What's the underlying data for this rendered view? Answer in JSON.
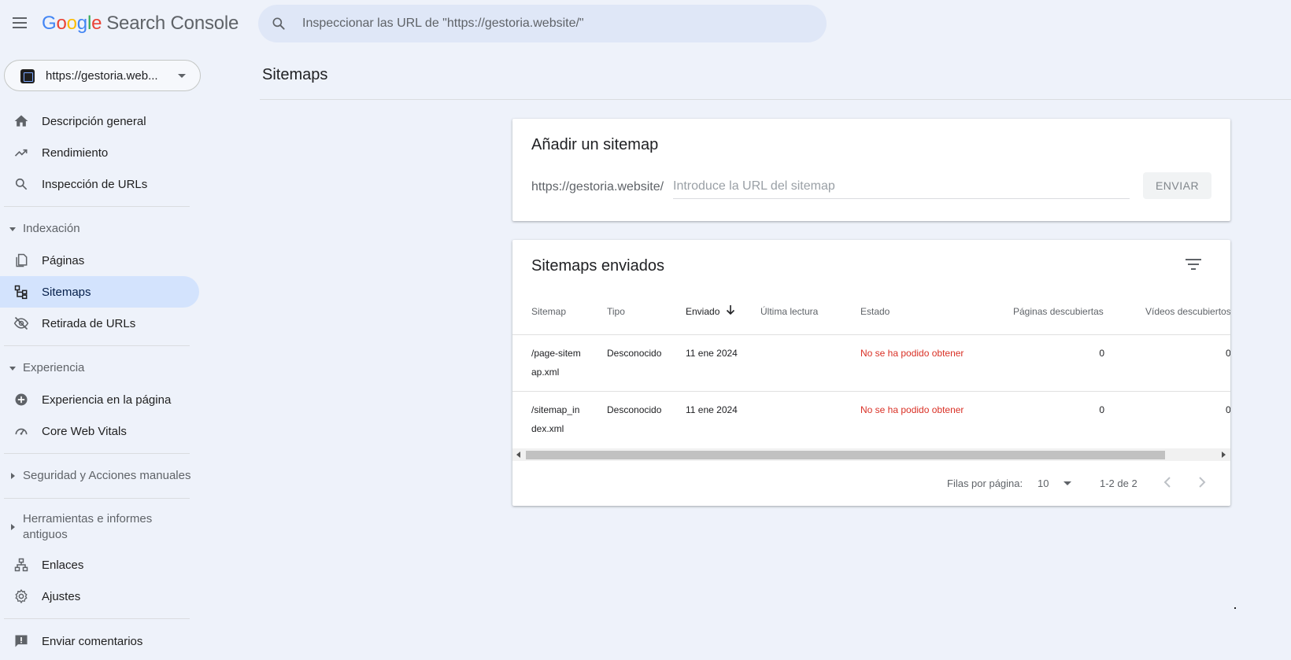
{
  "header": {
    "logo_letters": [
      "G",
      "o",
      "o",
      "g",
      "l",
      "e"
    ],
    "product": "Search Console",
    "search_placeholder": "Inspeccionar las URL de \"https://gestoria.website/\""
  },
  "property": {
    "url": "https://gestoria.web..."
  },
  "nav": {
    "overview": "Descripción general",
    "performance": "Rendimiento",
    "url_inspection": "Inspección de URLs",
    "indexing_section": "Indexación",
    "pages": "Páginas",
    "sitemaps": "Sitemaps",
    "removals": "Retirada de URLs",
    "experience_section": "Experiencia",
    "page_experience": "Experiencia en la página",
    "core_web_vitals": "Core Web Vitals",
    "security_section": "Seguridad y Acciones manuales",
    "legacy_section": "Herramientas e informes antiguos",
    "links": "Enlaces",
    "settings": "Ajustes",
    "feedback": "Enviar comentarios"
  },
  "main": {
    "page_title": "Sitemaps",
    "add_card": {
      "title": "Añadir un sitemap",
      "prefix": "https://gestoria.website/",
      "input_placeholder": "Introduce la URL del sitemap",
      "submit_label": "ENVIAR"
    },
    "list_card": {
      "title": "Sitemaps enviados",
      "columns": {
        "sitemap": "Sitemap",
        "type": "Tipo",
        "submitted": "Enviado",
        "last_read": "Última lectura",
        "status": "Estado",
        "pages": "Páginas descubiertas",
        "videos": "Vídeos descubiertos"
      },
      "rows": [
        {
          "sitemap_l1": "/page-sitem",
          "sitemap_l2": "ap.xml",
          "type": "Desconocido",
          "submitted": "11 ene 2024",
          "last_read": "",
          "status": "No se ha podido obtener",
          "pages": "0",
          "videos": "0"
        },
        {
          "sitemap_l1": "/sitemap_in",
          "sitemap_l2": "dex.xml",
          "type": "Desconocido",
          "submitted": "11 ene 2024",
          "last_read": "",
          "status": "No se ha podido obtener",
          "pages": "0",
          "videos": "0"
        }
      ],
      "pager": {
        "rows_per_page_label": "Filas por página:",
        "rows_per_page_value": "10",
        "range": "1-2 de 2"
      }
    }
  },
  "colors": {
    "accent": "#d3e3fd",
    "error": "#d93025",
    "background": "#eef2fa"
  },
  "icons": {
    "menu": "hamburger-icon",
    "search": "search-icon",
    "home": "home-icon",
    "performance": "trending-up-icon",
    "filter": "filter-icon",
    "sort": "arrow-down-icon"
  }
}
